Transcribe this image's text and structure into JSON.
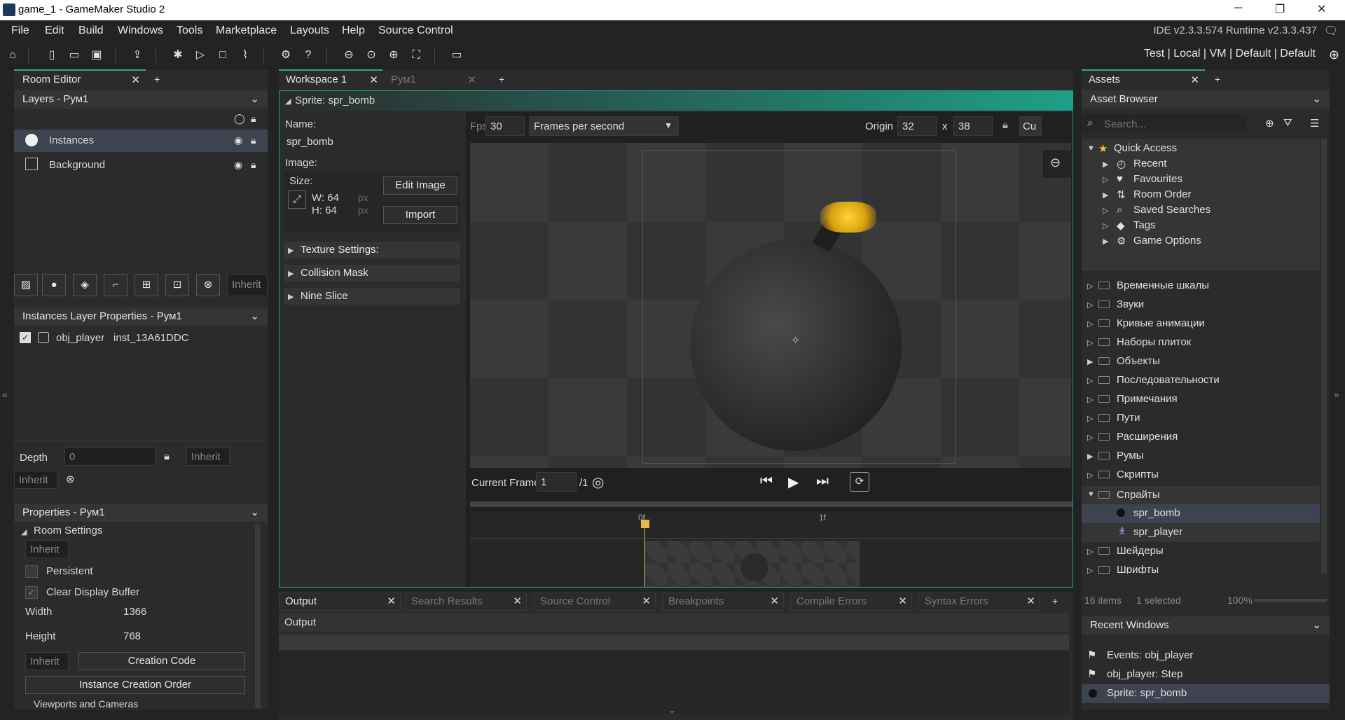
{
  "window": {
    "title": "game_1 - GameMaker Studio 2",
    "minimize": "─",
    "maximize": "❐",
    "close": "✕"
  },
  "menu": {
    "items": [
      "File",
      "Edit",
      "Build",
      "Windows",
      "Tools",
      "Marketplace",
      "Layouts",
      "Help",
      "Source Control"
    ],
    "ide_version": "IDE v2.3.3.574  Runtime v2.3.3.437"
  },
  "toolbar": {
    "targets": "Test  |  Local  |  VM  |  Default  |  Default"
  },
  "room_editor": {
    "tab_label": "Room Editor",
    "layers_header": "Layers - Рум1",
    "layers": [
      {
        "name": "Instances"
      },
      {
        "name": "Background"
      }
    ],
    "inherit_button": "Inherit",
    "instances_header": "Instances Layer Properties - Рум1",
    "instance": {
      "object": "obj_player",
      "id": "inst_13A61DDC"
    },
    "depth_label": "Depth",
    "depth_value": "0",
    "inherit1": "Inherit",
    "inherit2": "Inherit",
    "properties_header": "Properties - Рум1",
    "room_settings": "Room Settings",
    "inherit3": "Inherit",
    "persistent": "Persistent",
    "clear_display_buffer": "Clear Display Buffer",
    "width_label": "Width",
    "width_value": "1366",
    "height_label": "Height",
    "height_value": "768",
    "inherit4": "Inherit",
    "creation_code": "Creation Code",
    "instance_creation_order": "Instance Creation Order",
    "viewports": "Viewports and Cameras"
  },
  "workspace": {
    "tabs": [
      {
        "label": "Workspace 1"
      },
      {
        "label": "Рум1"
      }
    ],
    "sprite_title": "Sprite: spr_bomb",
    "name_label": "Name:",
    "name_value": "spr_bomb",
    "image_label": "Image:",
    "size_label": "Size:",
    "w_label": "W: 64",
    "h_label": "H: 64",
    "px": "px",
    "edit_image": "Edit Image",
    "import": "Import",
    "sections": [
      "Texture Settings:",
      "Collision Mask",
      "Nine Slice"
    ],
    "fps_label": "Fps",
    "fps_value": "30",
    "fps_mode": "Frames per second",
    "origin_label": "Origin",
    "origin_x": "32",
    "origin_sep": "x",
    "origin_y": "38",
    "origin_preset": "Cu",
    "current_frame_label": "Current Frame:",
    "current_frame_value": "1",
    "frame_total": "/1",
    "timeline_marks": [
      "0f",
      "1f"
    ]
  },
  "output": {
    "tabs": [
      "Output",
      "Search Results",
      "Source Control",
      "Breakpoints",
      "Compile Errors",
      "Syntax Errors"
    ],
    "header": "Output",
    "add": "+"
  },
  "assets": {
    "tab_label": "Assets",
    "browser_label": "Asset Browser",
    "search_placeholder": "Search...",
    "quick_access": "Quick Access",
    "quick_items": [
      "Recent",
      "Favourites",
      "Room Order",
      "Saved Searches",
      "Tags",
      "Game Options"
    ],
    "folders": [
      "Временные шкалы",
      "Звуки",
      "Кривые анимации",
      "Наборы плиток",
      "Объекты",
      "Последовательности",
      "Примечания",
      "Пути",
      "Расширения",
      "Румы",
      "Скрипты",
      "Спрайты"
    ],
    "sprites": [
      "spr_bomb",
      "spr_player"
    ],
    "folders_after": [
      "Шейдеры",
      "Шрифты"
    ],
    "status_items": "16 items",
    "status_selected": "1 selected",
    "zoom": "100%",
    "recent_header": "Recent Windows",
    "recent_items": [
      "Events: obj_player",
      "obj_player: Step",
      "Sprite: spr_bomb"
    ]
  },
  "colors": {
    "accent": "#3aa87a",
    "selection": "#3d4350",
    "sprite_header": "#1f9f88"
  }
}
